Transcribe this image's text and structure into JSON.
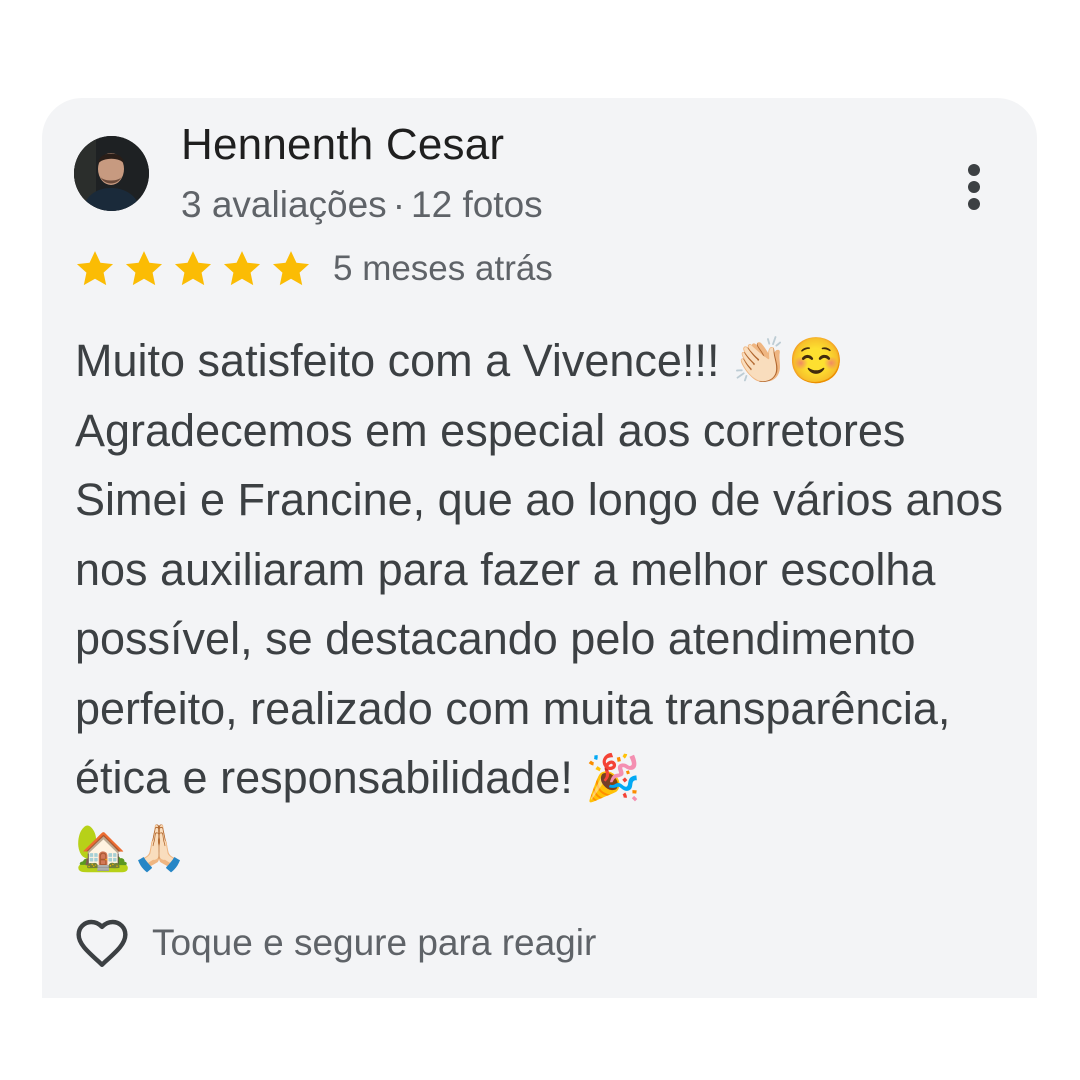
{
  "review": {
    "author_name": "Hennenth Cesar",
    "reviews_count": "3 avaliações",
    "separator": "·",
    "photos_count": "12 fotos",
    "rating": 5,
    "rating_max": 5,
    "date": "5 meses atrás",
    "text": "Muito satisfeito com a Vivence!!! 👏🏻☺️\nAgradecemos em especial aos corretores Simei e Francine, que ao longo de vários anos nos auxiliaram para fazer a melhor escolha possível, se destacando pelo atendimento perfeito, realizado com muita transparência, ética e responsabilidade! 🎉\n🏡🙏🏻",
    "react_label": "Toque e segure para reagir"
  },
  "icons": {
    "avatar": "avatar-photo",
    "more": "more-vert-icon",
    "star": "star-icon",
    "heart": "heart-outline-icon"
  },
  "colors": {
    "card_background": "#f3f4f6",
    "star": "#fbbc04",
    "primary_text": "#1f1f1f",
    "secondary_text": "#5f6368",
    "body_text": "#3c4043"
  }
}
